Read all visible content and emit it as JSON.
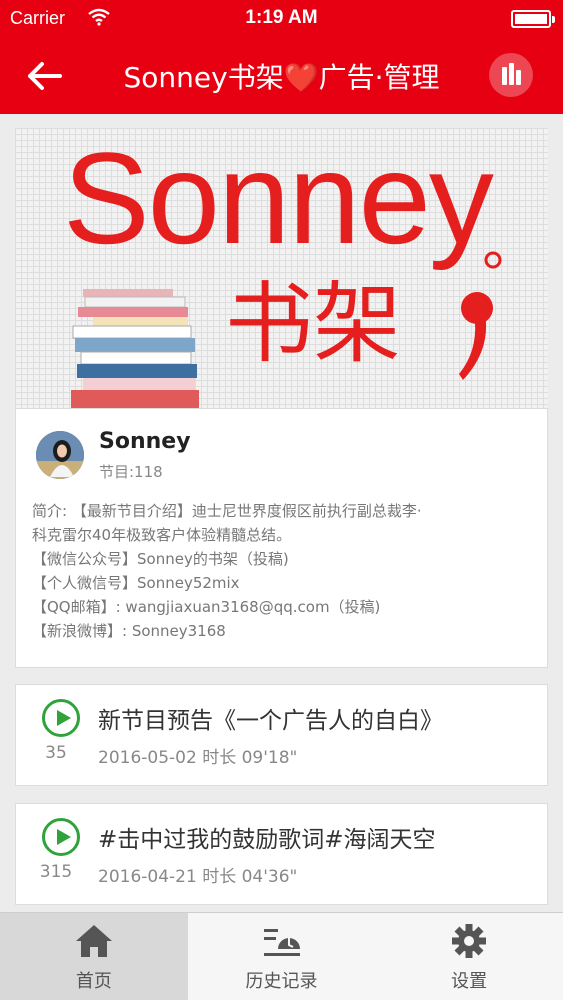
{
  "status_bar": {
    "carrier": "Carrier",
    "time": "1:19 AM"
  },
  "nav": {
    "title": "Sonney书架❤️广告·管理",
    "back_icon": "arrow-left-icon",
    "right_icon": "equalizer-icon"
  },
  "banner": {
    "title": "Sonney",
    "subtitle": "书架"
  },
  "profile": {
    "name": "Sonney",
    "program_count": "节目:118",
    "description_lines": [
      "简介: 【最新节目介绍】迪士尼世界度假区前执行副总裁李·",
      "科克雷尔40年极致客户体验精髓总结。",
      "【微信公众号】Sonney的书架（投稿)",
      "【个人微信号】Sonney52mix",
      "【QQ邮箱】: wangjiaxuan3168@qq.com（投稿)",
      "【新浪微博】: Sonney3168"
    ]
  },
  "episodes": [
    {
      "title": "新节目预告《一个广告人的自白》",
      "plays": "35",
      "meta": "2016-05-02  时长 09'18\""
    },
    {
      "title": "#击中过我的鼓励歌词#海阔天空",
      "plays": "315",
      "meta": "2016-04-21  时长 04'36\""
    }
  ],
  "tabs": [
    {
      "label": "首页",
      "icon": "home-icon",
      "active": true
    },
    {
      "label": "历史记录",
      "icon": "history-icon",
      "active": false
    },
    {
      "label": "设置",
      "icon": "gear-icon",
      "active": false
    }
  ],
  "colors": {
    "brand_red": "#e60012",
    "play_green": "#2fa23a"
  }
}
